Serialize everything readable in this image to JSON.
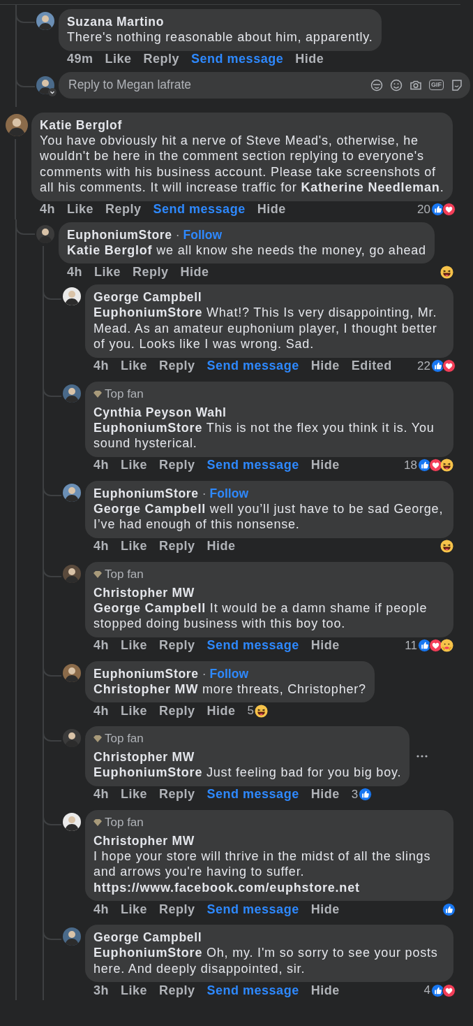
{
  "earlier_replies": {
    "comments": [
      {
        "author": "Suzana Martino",
        "text": "There's nothing reasonable about him, apparently.",
        "time": "49m",
        "actions": [
          {
            "label": "Like",
            "kind": "plain"
          },
          {
            "label": "Reply",
            "kind": "plain"
          },
          {
            "label": "Send message",
            "kind": "link"
          },
          {
            "label": "Hide",
            "kind": "plain"
          }
        ]
      }
    ],
    "reply_field": {
      "placeholder": "Reply to Megan lafrate",
      "gif_label": "GIF"
    }
  },
  "comments": [
    {
      "author": "Katie Berglof",
      "text": "You have obviously hit a nerve of Steve Mead's, otherwise, he wouldn't be here in the comment section replying to everyone's comments with his business account. Please take screenshots of all his comments. It will increase traffic for **Katherine Needleman**.",
      "time": "4h",
      "actions": [
        {
          "label": "Like",
          "kind": "plain"
        },
        {
          "label": "Reply",
          "kind": "plain"
        },
        {
          "label": "Send message",
          "kind": "link"
        },
        {
          "label": "Hide",
          "kind": "plain"
        }
      ],
      "reactions": {
        "count": "20",
        "items": [
          {
            "kind": "like"
          },
          {
            "kind": "love"
          }
        ]
      },
      "children": [
        {
          "author": "EuphoniumStore",
          "follow": {
            "separator": "·",
            "label": "Follow"
          },
          "text": "**Katie Berglof** we all know she needs the money, go ahead",
          "time": "4h",
          "actions": [
            {
              "label": "Like",
              "kind": "plain"
            },
            {
              "label": "Reply",
              "kind": "plain"
            },
            {
              "label": "Hide",
              "kind": "plain"
            }
          ],
          "reactions": {
            "items": [
              {
                "kind": "haha"
              }
            ]
          },
          "children": [
            {
              "author": "George Campbell",
              "text": "**EuphoniumStore** What!? This Is very disappointing, Mr. Mead. As an amateur euphonium player, I thought better of you. Looks like I was wrong. Sad.",
              "time": "4h",
              "actions": [
                {
                  "label": "Like",
                  "kind": "plain"
                },
                {
                  "label": "Reply",
                  "kind": "plain"
                },
                {
                  "label": "Send message",
                  "kind": "link"
                },
                {
                  "label": "Hide",
                  "kind": "plain"
                }
              ],
              "edited": "Edited",
              "reactions": {
                "count": "22",
                "items": [
                  {
                    "kind": "like"
                  },
                  {
                    "kind": "love"
                  }
                ]
              }
            },
            {
              "author": "Cynthia Peyson Wahl",
              "badge": "Top fan",
              "text": "**EuphoniumStore** This is not the flex you think it is. You sound hysterical.",
              "time": "4h",
              "actions": [
                {
                  "label": "Like",
                  "kind": "plain"
                },
                {
                  "label": "Reply",
                  "kind": "plain"
                },
                {
                  "label": "Send message",
                  "kind": "link"
                },
                {
                  "label": "Hide",
                  "kind": "plain"
                }
              ],
              "reactions": {
                "count": "18",
                "items": [
                  {
                    "kind": "like"
                  },
                  {
                    "kind": "love"
                  },
                  {
                    "kind": "haha"
                  }
                ]
              }
            },
            {
              "author": "EuphoniumStore",
              "follow": {
                "separator": "·",
                "label": "Follow"
              },
              "text": "**George Campbell** well you’ll just have to be sad George, I’ve had enough of this nonsense.",
              "time": "4h",
              "actions": [
                {
                  "label": "Like",
                  "kind": "plain"
                },
                {
                  "label": "Reply",
                  "kind": "plain"
                },
                {
                  "label": "Hide",
                  "kind": "plain"
                }
              ],
              "reactions": {
                "items": [
                  {
                    "kind": "haha"
                  }
                ]
              }
            },
            {
              "author": "Christopher MW",
              "badge": "Top fan",
              "text": "**George Campbell** It would be a damn shame if people stopped doing business with this boy too.",
              "time": "4h",
              "actions": [
                {
                  "label": "Like",
                  "kind": "plain"
                },
                {
                  "label": "Reply",
                  "kind": "plain"
                },
                {
                  "label": "Send message",
                  "kind": "link"
                },
                {
                  "label": "Hide",
                  "kind": "plain"
                }
              ],
              "reactions": {
                "count": "11",
                "items": [
                  {
                    "kind": "like"
                  },
                  {
                    "kind": "love"
                  },
                  {
                    "kind": "care"
                  }
                ]
              }
            },
            {
              "author": "EuphoniumStore",
              "follow": {
                "separator": "·",
                "label": "Follow"
              },
              "text": "**Christopher MW** more threats, Christopher?",
              "time": "4h",
              "actions": [
                {
                  "label": "Like",
                  "kind": "plain"
                },
                {
                  "label": "Reply",
                  "kind": "plain"
                },
                {
                  "label": "Hide",
                  "kind": "plain"
                }
              ],
              "reactions": {
                "count": "5",
                "items": [
                  {
                    "kind": "haha"
                  }
                ]
              },
              "reactions_inline": true
            },
            {
              "author": "Christopher MW",
              "badge": "Top fan",
              "text": "**EuphoniumStore** Just feeling bad for you big boy.",
              "more_menu": true,
              "time": "4h",
              "actions": [
                {
                  "label": "Like",
                  "kind": "plain"
                },
                {
                  "label": "Reply",
                  "kind": "plain"
                },
                {
                  "label": "Send message",
                  "kind": "link"
                },
                {
                  "label": "Hide",
                  "kind": "plain"
                }
              ],
              "reactions": {
                "count": "3",
                "items": [
                  {
                    "kind": "like"
                  }
                ]
              },
              "reactions_inline": true
            },
            {
              "author": "Christopher MW",
              "badge": "Top fan",
              "text": "I hope your store will thrive in the midst of all the slings and arrows you're having to suffer. **https://www.facebook.com/euphstore.net**",
              "time": "4h",
              "actions": [
                {
                  "label": "Like",
                  "kind": "plain"
                },
                {
                  "label": "Reply",
                  "kind": "plain"
                },
                {
                  "label": "Send message",
                  "kind": "link"
                },
                {
                  "label": "Hide",
                  "kind": "plain"
                }
              ],
              "reactions": {
                "items": [
                  {
                    "kind": "like"
                  }
                ]
              }
            },
            {
              "author": "George Campbell",
              "text": "**EuphoniumStore** Oh, my. I'm so sorry to see your posts here. And deeply disappointed, sir.",
              "time": "3h",
              "actions": [
                {
                  "label": "Like",
                  "kind": "plain"
                },
                {
                  "label": "Reply",
                  "kind": "plain"
                },
                {
                  "label": "Send message",
                  "kind": "link"
                },
                {
                  "label": "Hide",
                  "kind": "plain"
                }
              ],
              "reactions": {
                "count": "4",
                "items": [
                  {
                    "kind": "like"
                  },
                  {
                    "kind": "love"
                  }
                ]
              }
            }
          ]
        }
      ]
    }
  ]
}
